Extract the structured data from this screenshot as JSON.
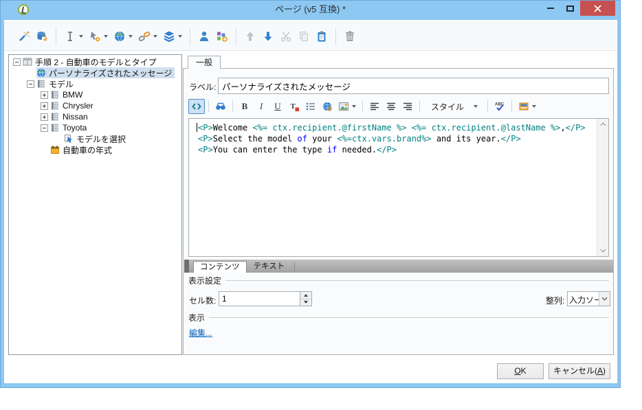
{
  "window": {
    "title": "ページ (v5 互換) *"
  },
  "titlebar": {
    "controls": [
      "minimize",
      "maximize",
      "close"
    ]
  },
  "toolbar": {
    "items": [
      {
        "name": "wizard"
      },
      {
        "name": "database-restore"
      },
      "|",
      {
        "name": "input-field",
        "dropdown": true
      },
      {
        "name": "control-settings",
        "dropdown": true
      },
      {
        "name": "web-page",
        "dropdown": true
      },
      {
        "name": "link",
        "dropdown": true
      },
      {
        "name": "package",
        "dropdown": true
      },
      "|",
      {
        "name": "recipient"
      },
      {
        "name": "add-content"
      },
      "|",
      {
        "name": "move-up",
        "disabled": true
      },
      {
        "name": "move-down"
      },
      {
        "name": "cut",
        "disabled": true
      },
      {
        "name": "copy",
        "disabled": true
      },
      {
        "name": "paste"
      },
      "|",
      {
        "name": "delete"
      }
    ]
  },
  "tree": {
    "items": [
      {
        "indent": 0,
        "expander": "minus",
        "icon": "form-icon",
        "label": "手順 2 - 自動車のモデルとタイプ",
        "selected": false
      },
      {
        "indent": 1,
        "expander": null,
        "icon": "globe-icon",
        "label": "パーソナライズされたメッセージ",
        "selected": true
      },
      {
        "indent": 1,
        "expander": "minus",
        "icon": "table-icon",
        "label": "モデル",
        "selected": false
      },
      {
        "indent": 2,
        "expander": "plus",
        "icon": "table-icon",
        "label": "BMW",
        "selected": false
      },
      {
        "indent": 2,
        "expander": "plus",
        "icon": "table-icon",
        "label": "Chrysler",
        "selected": false
      },
      {
        "indent": 2,
        "expander": "plus",
        "icon": "table-icon",
        "label": "Nissan",
        "selected": false
      },
      {
        "indent": 2,
        "expander": "minus",
        "icon": "table-icon",
        "label": "Toyota",
        "selected": false
      },
      {
        "indent": 3,
        "expander": null,
        "icon": "select-icon",
        "label": "モデルを選択",
        "selected": false
      },
      {
        "indent": 2,
        "expander": null,
        "icon": "calendar-icon",
        "label": "自動車の年式",
        "selected": false
      }
    ]
  },
  "editor_panel": {
    "tab": "一般",
    "label_field": {
      "label": "ラベル:",
      "value": "パーソナライズされたメッセージ"
    },
    "toolbar": {
      "items": [
        {
          "name": "source-code",
          "active": true
        },
        "|",
        {
          "name": "find"
        },
        "|",
        {
          "name": "bold"
        },
        {
          "name": "italic"
        },
        {
          "name": "underline"
        },
        {
          "name": "font-color"
        },
        {
          "name": "bullet-list"
        },
        {
          "name": "hyperlink"
        },
        {
          "name": "image",
          "dropdown": true
        },
        "|",
        {
          "name": "align-left"
        },
        {
          "name": "align-center"
        },
        {
          "name": "align-right"
        },
        "|",
        {
          "name": "style-combo",
          "label": "スタイル",
          "dropdown": true
        },
        "|",
        {
          "name": "spell-check"
        },
        "|",
        {
          "name": "personalization-block",
          "dropdown": true
        }
      ]
    },
    "code_lines": [
      [
        {
          "t": "<P>",
          "c": "tag"
        },
        {
          "t": "Welcome ",
          "c": "text"
        },
        {
          "t": "<%= ctx.recipient.@firstName %>",
          "c": "expr"
        },
        {
          "t": " ",
          "c": "text"
        },
        {
          "t": "<%= ctx.recipient.@lastName %>",
          "c": "expr"
        },
        {
          "t": ",",
          "c": "text"
        },
        {
          "t": "</P>",
          "c": "tag"
        }
      ],
      [
        {
          "t": "<P>",
          "c": "tag"
        },
        {
          "t": "Select the model ",
          "c": "text"
        },
        {
          "t": "of",
          "c": "kw"
        },
        {
          "t": " your ",
          "c": "text"
        },
        {
          "t": "<%=ctx.vars.brand%>",
          "c": "expr"
        },
        {
          "t": " and its year.",
          "c": "text"
        },
        {
          "t": "</P>",
          "c": "tag"
        }
      ],
      [
        {
          "t": "<P>",
          "c": "tag"
        },
        {
          "t": "You can enter the type ",
          "c": "text"
        },
        {
          "t": "if",
          "c": "kw"
        },
        {
          "t": " needed.",
          "c": "text"
        },
        {
          "t": "</P>",
          "c": "tag"
        }
      ]
    ],
    "bottom_tabs": [
      {
        "label": "コンテンツ",
        "active": true
      },
      {
        "label": "テキスト",
        "active": false
      }
    ],
    "display_settings": {
      "group_label": "表示設定",
      "cell_label": "セル数:",
      "cell_value": "1",
      "align_label": "整列:",
      "align_value": "入力ソー"
    },
    "display": {
      "group_label": "表示",
      "edit_link": "編集..."
    }
  },
  "footer": {
    "ok": {
      "pre": "",
      "u": "O",
      "post": "K"
    },
    "cancel": {
      "pre": "キャンセル(",
      "u": "A",
      "post": ")"
    }
  },
  "colors": {
    "titlebar": "#8cc8f2",
    "close_button": "#c75050",
    "tree_selection": "#d0dff0",
    "code_tag": "#008080",
    "code_keyword": "#0000ff",
    "link": "#0563c1"
  }
}
